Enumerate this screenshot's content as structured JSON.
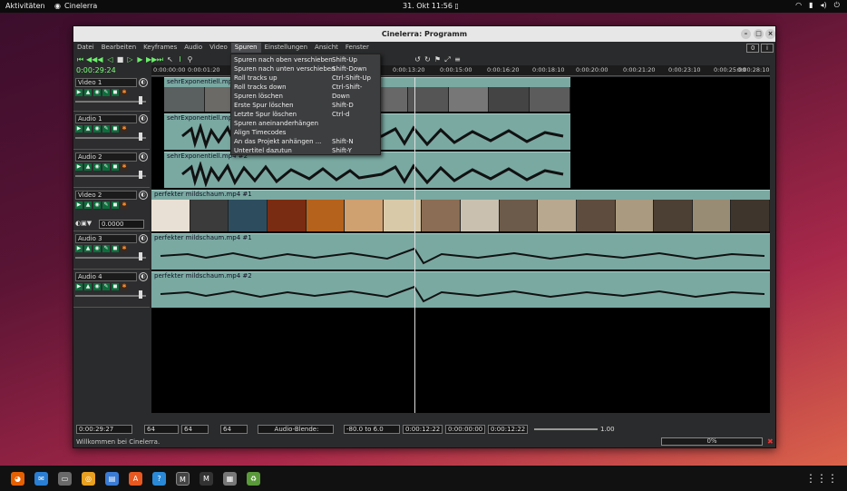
{
  "topbar": {
    "activities": "Aktivitäten",
    "app_name": "Cinelerra",
    "clock": "31. Okt  11:56"
  },
  "window": {
    "title": "Cinelerra: Programm"
  },
  "menubar": [
    "Datei",
    "Bearbeiten",
    "Keyframes",
    "Audio",
    "Video",
    "Spuren",
    "Einstellungen",
    "Ansicht",
    "Fenster"
  ],
  "menubar_right": {
    "zero_btn": "0",
    "info_btn": "i"
  },
  "timecode": "0:00:29:24",
  "ruler": [
    "0:00:00:00",
    "0:00:01:20",
    "",
    "0:00:13:20",
    "0:00:15:00",
    "0:00:16:20",
    "0:00:18:10",
    "0:00:20:00",
    "0:00:21:20",
    "0:00:23:10",
    "0:00:25:00",
    "0:00:26:20",
    "0:00:28:10"
  ],
  "tracks": [
    {
      "name": "Video 1",
      "edit": "sehrExponentiell.mp4"
    },
    {
      "name": "Audio 1",
      "edit": "sehrExponentiell.mp4"
    },
    {
      "name": "Audio 2",
      "edit": "sehrExponentiell.mp4 #2"
    },
    {
      "name": "Video 2",
      "edit": "perfekter mildschaum.mp4 #1"
    },
    {
      "name": "Audio 3",
      "edit": "perfekter mildschaum.mp4 #1"
    },
    {
      "name": "Audio 4",
      "edit": "perfekter mildschaum.mp4 #2"
    }
  ],
  "video2_extra": {
    "value": "0.0000"
  },
  "spuren_menu": [
    {
      "label": "Spuren nach oben verschieben",
      "shortcut": "Shift-Up"
    },
    {
      "label": "Spuren nach unten verschieben",
      "shortcut": "Shift-Down"
    },
    {
      "label": "Roll tracks up",
      "shortcut": "Ctrl-Shift-Up"
    },
    {
      "label": "Roll tracks down",
      "shortcut": "Ctrl-Shift-Down"
    },
    {
      "label": "Spuren löschen",
      "shortcut": ""
    },
    {
      "label": "Erste Spur löschen",
      "shortcut": "Shift-D"
    },
    {
      "label": "Letzte Spur löschen",
      "shortcut": "Ctrl-d"
    },
    {
      "label": "Spuren aneinanderhängen",
      "shortcut": ""
    },
    {
      "label": "Align Timecodes",
      "shortcut": ""
    },
    {
      "label": "An das Projekt anhängen ...",
      "shortcut": "Shift-N"
    },
    {
      "label": "Untertitel dazutun",
      "shortcut": "Shift-Y"
    }
  ],
  "bottombar": {
    "position": "0:00:29:27",
    "zoom1": "64",
    "zoom2": "64",
    "zoom3": "64",
    "audio_blend": "Audio-Blende:",
    "range": "-80.0 to 6.0",
    "sel_start": "0:00:12:22",
    "sel_len": "0:00:00:00",
    "sel_end": "0:00:12:22",
    "speed": "1.00"
  },
  "status": {
    "message": "Willkommen bei Cinelerra.",
    "progress": "0%"
  },
  "colors": {
    "accent_green": "#6cf06c",
    "edit_teal": "#7aa9a2",
    "record_red": "#e33"
  }
}
